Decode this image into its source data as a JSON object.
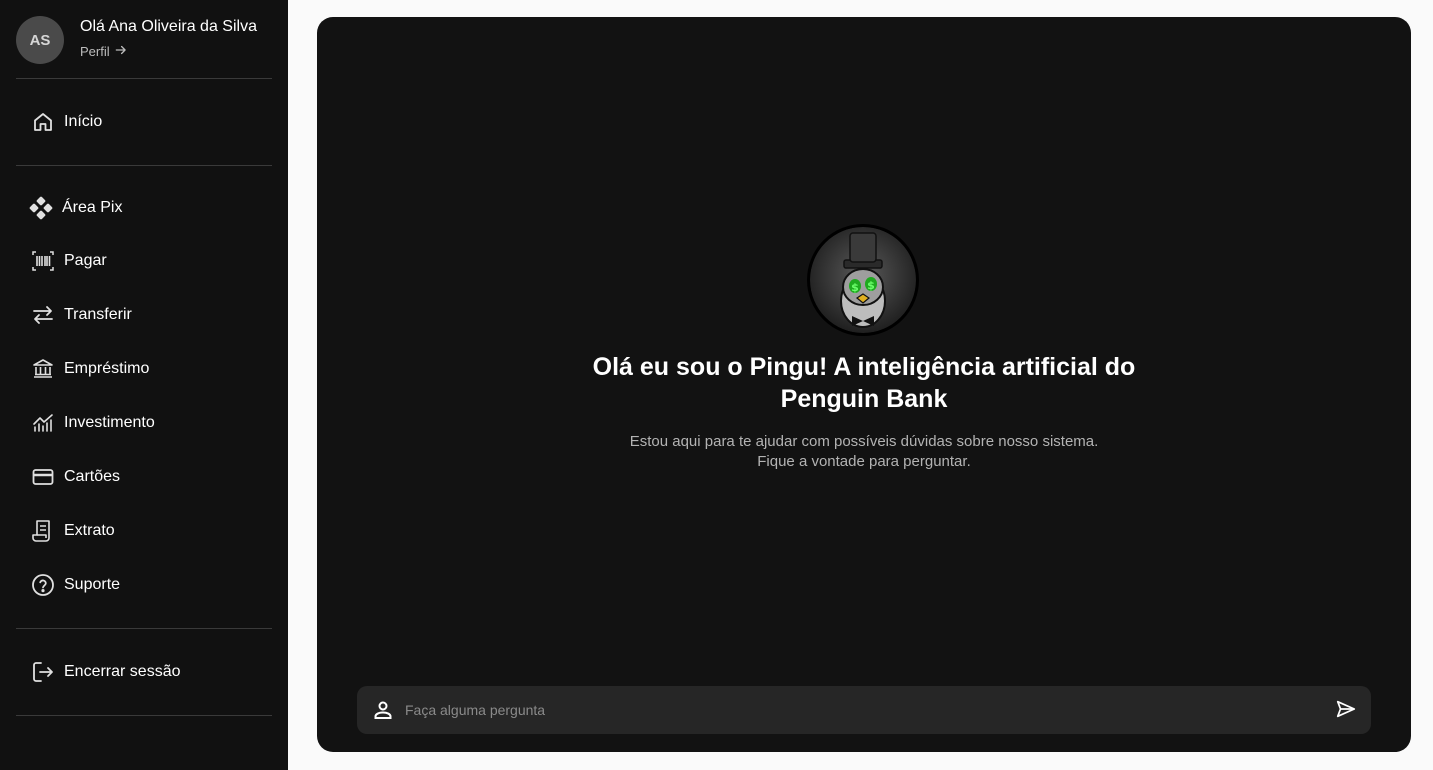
{
  "user": {
    "initials": "AS",
    "greeting": "Olá Ana Oliveira da Silva",
    "profile_link": "Perfil"
  },
  "sidebar": {
    "home": {
      "label": "Início",
      "icon": "home-icon"
    },
    "items": [
      {
        "label": "Área Pix",
        "icon": "pix-icon"
      },
      {
        "label": "Pagar",
        "icon": "barcode-icon"
      },
      {
        "label": "Transferir",
        "icon": "transfer-arrows-icon"
      },
      {
        "label": "Empréstimo",
        "icon": "bank-icon"
      },
      {
        "label": "Investimento",
        "icon": "chart-icon"
      },
      {
        "label": "Cartões",
        "icon": "credit-card-icon"
      },
      {
        "label": "Extrato",
        "icon": "receipt-icon"
      },
      {
        "label": "Suporte",
        "icon": "help-circle-icon"
      }
    ],
    "logout": {
      "label": "Encerrar sessão",
      "icon": "logout-icon"
    }
  },
  "chat": {
    "title": "Olá eu sou o Pingu! A inteligência artificial do Penguin Bank",
    "subtitle": "Estou aqui para te ajudar com possíveis dúvidas sobre nosso sistema. Fique a vontade para perguntar.",
    "input_placeholder": "Faça alguma pergunta",
    "input_value": ""
  },
  "colors": {
    "sidebar_bg": "#111111",
    "page_bg": "#fafafa",
    "panel_bg": "#121212",
    "input_bg": "#262626",
    "accent_green": "#2bd62b"
  }
}
